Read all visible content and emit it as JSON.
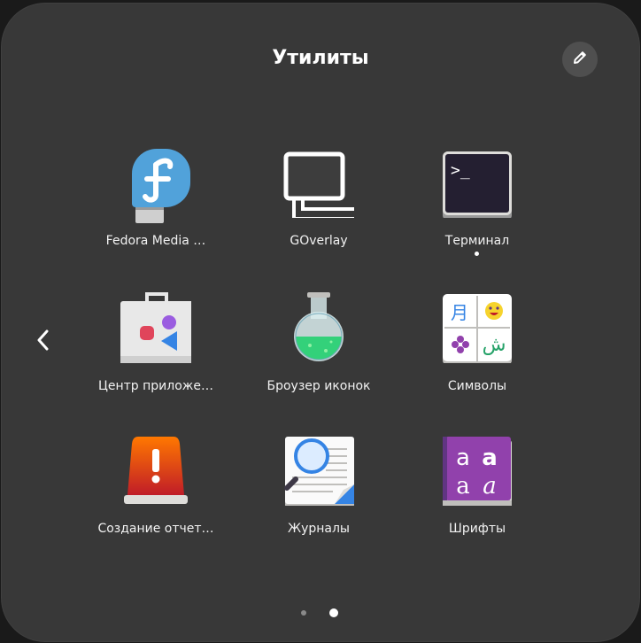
{
  "folder": {
    "title": "Утилиты"
  },
  "apps": [
    {
      "label": "Fedora Media …",
      "icon": "fedora-media-writer-icon"
    },
    {
      "label": "GOverlay",
      "icon": "goverlay-icon"
    },
    {
      "label": "Терминал",
      "icon": "terminal-icon",
      "running": true
    },
    {
      "label": "Центр приложе…",
      "icon": "software-center-icon"
    },
    {
      "label": "Броузер иконок",
      "icon": "icon-browser-icon"
    },
    {
      "label": "Символы",
      "icon": "characters-icon"
    },
    {
      "label": "Создание отчет…",
      "icon": "problem-reporting-icon"
    },
    {
      "label": "Журналы",
      "icon": "logs-icon"
    },
    {
      "label": "Шрифты",
      "icon": "fonts-icon"
    }
  ],
  "icons": {
    "terminal_prompt": ">_",
    "characters": [
      "月",
      "ش"
    ],
    "fonts": [
      "a",
      "a",
      "a",
      "a"
    ]
  },
  "pager": {
    "pages": 2,
    "current_page": 2
  },
  "colors": {
    "background": "#383838",
    "text": "#ffffff"
  }
}
